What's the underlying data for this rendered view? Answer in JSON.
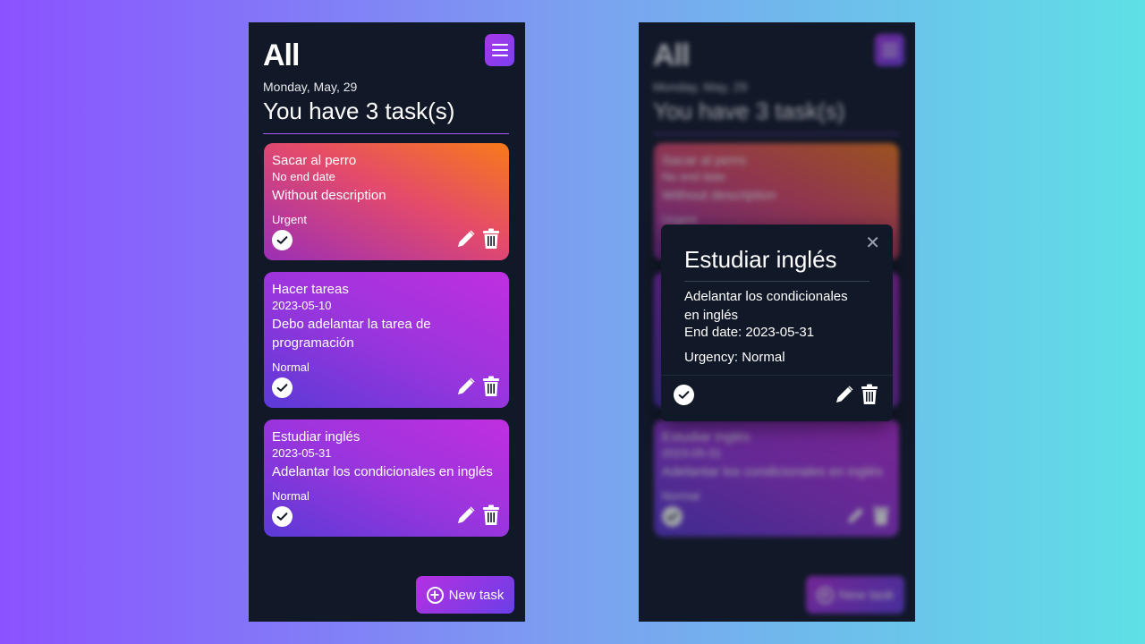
{
  "screen": {
    "title": "All",
    "date": "Monday, May, 29",
    "count_text": "You have 3 task(s)",
    "new_task_label": "New task"
  },
  "tasks": [
    {
      "title": "Sacar al perro",
      "date": "No end date",
      "description": "Without description",
      "urgency": "Urgent"
    },
    {
      "title": "Hacer tareas",
      "date": "2023-05-10",
      "description": "Debo adelantar la tarea de programación",
      "urgency": "Normal"
    },
    {
      "title": "Estudiar inglés",
      "date": "2023-05-31",
      "description": "Adelantar los condicionales en inglés",
      "urgency": "Normal"
    }
  ],
  "modal": {
    "title": "Estudiar inglés",
    "close_glyph": "✕",
    "description": "Adelantar los condicionales en inglés",
    "end_date": "End date: 2023-05-31",
    "urgency": "Urgency: Normal"
  },
  "icons": {
    "menu": "hamburger-menu-icon",
    "check": "check-circle-icon",
    "edit": "pencil-icon",
    "delete": "trash-icon",
    "add": "plus-circle-icon",
    "close": "close-icon"
  },
  "colors": {
    "background": "#111827",
    "accent": "#a855f7",
    "urgent_card_start": "#9b2fb6",
    "urgent_card_end": "#f77a1a",
    "normal_card_start": "#5b3ad6",
    "normal_card_end": "#c02fe0"
  }
}
